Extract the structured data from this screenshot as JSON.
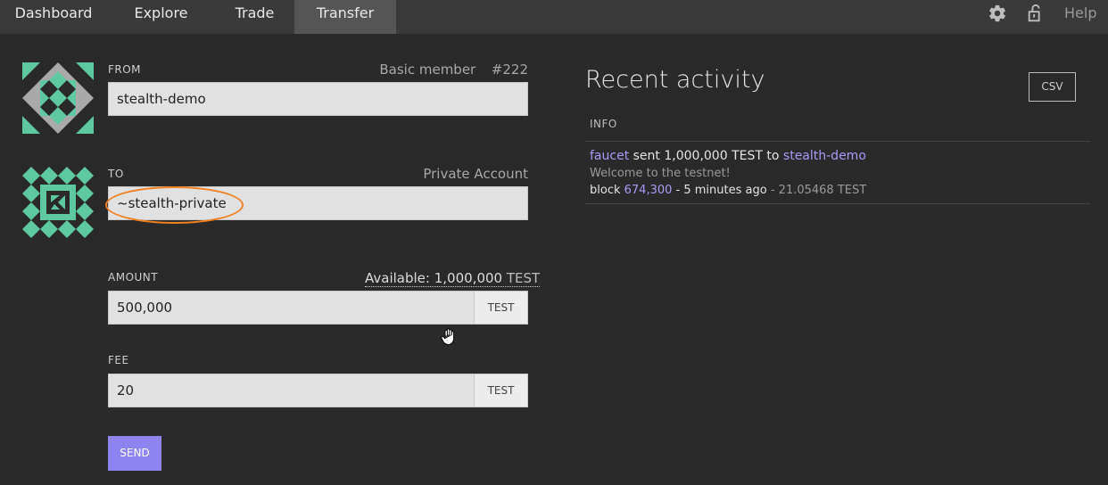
{
  "nav": {
    "tabs": [
      "Dashboard",
      "Explore",
      "Trade",
      "Transfer"
    ],
    "active_tab": "Transfer",
    "icons": [
      "gear-icon",
      "unlock-icon"
    ],
    "help_label": "Help"
  },
  "form": {
    "from": {
      "label": "FROM",
      "membership": "Basic member",
      "member_id": "#222",
      "value": "stealth-demo"
    },
    "to": {
      "label": "TO",
      "account_type": "Private Account",
      "value": "~stealth-private"
    },
    "amount": {
      "label": "AMOUNT",
      "available_prefix": "Available:",
      "available_amount": "1,000,000",
      "available_unit": "TEST",
      "value": "500,000",
      "unit": "TEST"
    },
    "fee": {
      "label": "FEE",
      "value": "20",
      "unit": "TEST"
    },
    "send_label": "SEND"
  },
  "activity": {
    "title": "Recent activity",
    "csv_label": "CSV",
    "column_header": "INFO",
    "items": [
      {
        "from": "faucet",
        "action": "sent",
        "amount": "1,000,000",
        "unit": "TEST",
        "to_word": "to",
        "to": "stealth-demo",
        "memo": "Welcome to the testnet!",
        "block_word": "block",
        "block": "674,300",
        "time": "- 5 minutes ago",
        "balance": "- 21.05468 TEST"
      }
    ]
  },
  "colors": {
    "background": "#2a2a2a",
    "nav_bar": "#3a3a3a",
    "active_tab": "#555555",
    "accent": "#8f85f2",
    "link": "#a69cf5",
    "identicon_green": "#5ec9a0",
    "highlight_ring": "#f08020"
  }
}
